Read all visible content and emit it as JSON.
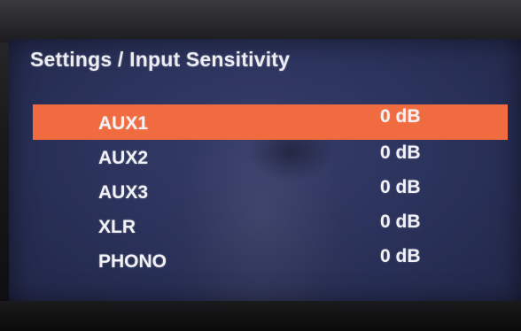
{
  "header": {
    "title": "Settings / Input Sensitivity"
  },
  "settings": {
    "items": [
      {
        "label": "AUX1",
        "value": "0 dB",
        "selected": true
      },
      {
        "label": "AUX2",
        "value": "0 dB",
        "selected": false
      },
      {
        "label": "AUX3",
        "value": "0 dB",
        "selected": false
      },
      {
        "label": "XLR",
        "value": "0 dB",
        "selected": false
      },
      {
        "label": "PHONO",
        "value": "0 dB",
        "selected": false
      }
    ]
  },
  "colors": {
    "screen_background": "#2a3159",
    "highlight": "#f06b3f",
    "text": "#f2f2f6"
  }
}
